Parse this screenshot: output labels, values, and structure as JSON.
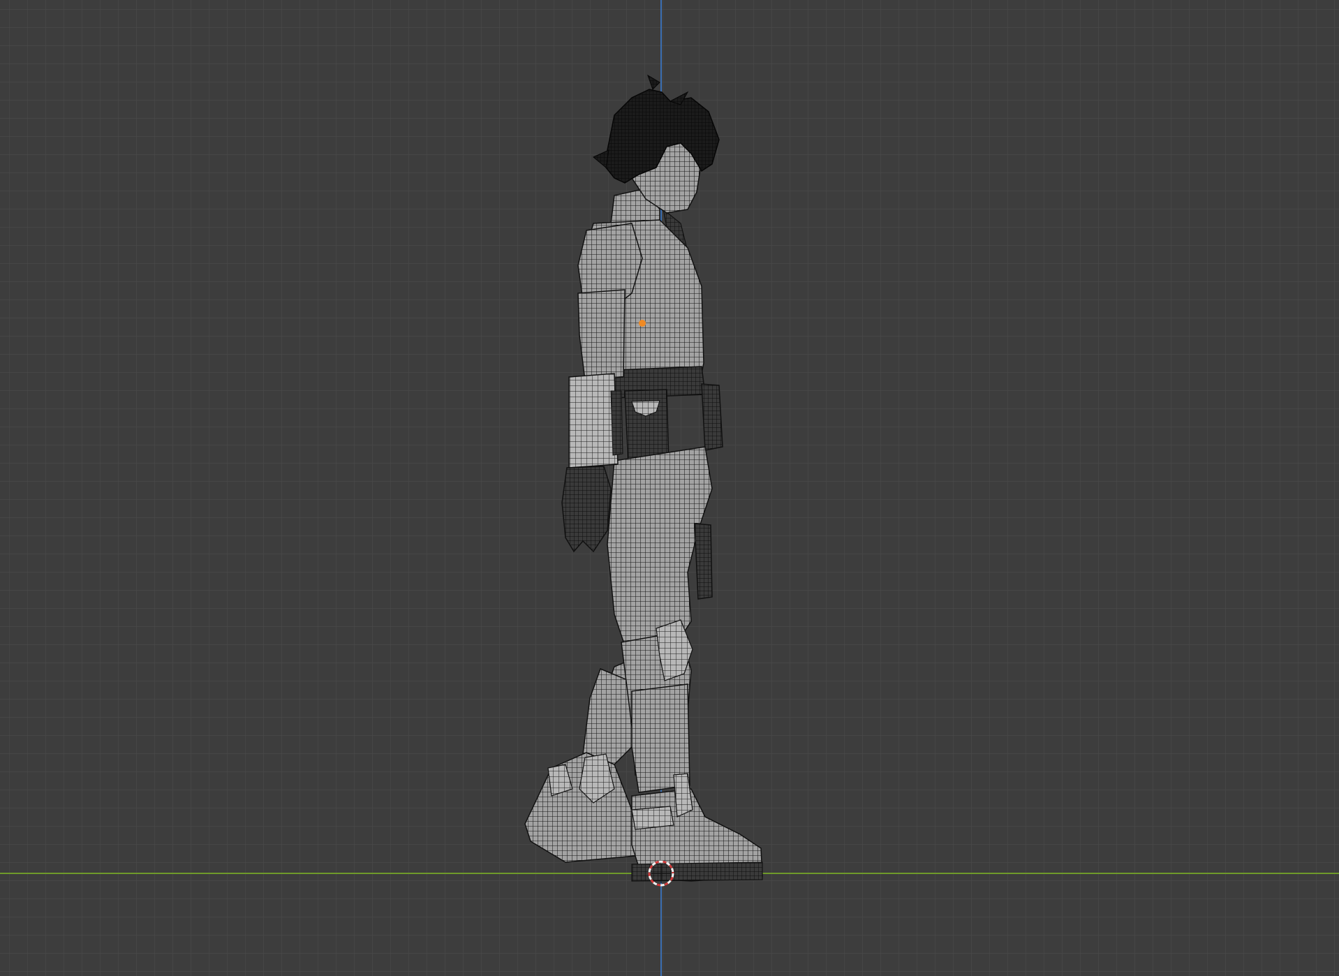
{
  "app": {
    "view_mode": "wireframe-overlay",
    "view_orientation": "side-orthographic"
  },
  "colors": {
    "background": "#3d3d3d",
    "grid_minor": "#474747",
    "grid_major": "#4f4f4f",
    "axis_x": "#6f9a2a",
    "axis_z": "#3b6fb3",
    "mesh_fill": "#9c9c9c",
    "mesh_dark": "#1f1f1f",
    "wire": "#141414",
    "origin": "#f08a24",
    "cursor_red": "#d33a3a",
    "cursor_white": "#f2f2f2"
  },
  "icons": {
    "origin": "object-origin-icon",
    "cursor": "3d-cursor-icon"
  }
}
